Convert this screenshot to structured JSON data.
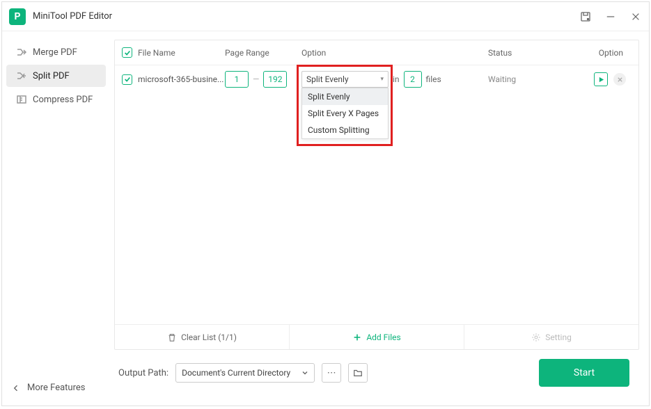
{
  "app": {
    "title": "MiniTool PDF Editor"
  },
  "sidebar": {
    "items": [
      {
        "label": "Merge PDF"
      },
      {
        "label": "Split PDF"
      },
      {
        "label": "Compress PDF"
      }
    ],
    "more": "More Features"
  },
  "table": {
    "headers": {
      "filename": "File Name",
      "range": "Page Range",
      "option": "Option",
      "status": "Status",
      "option2": "Option"
    },
    "row": {
      "filename": "microsoft-365-busine...",
      "range_from": "1",
      "range_to": "192",
      "select_value": "Split Evenly",
      "in_text": "in",
      "count": "2",
      "files_text": "files",
      "status": "Waiting"
    },
    "dropdown": [
      "Split Evenly",
      "Split Every X Pages",
      "Custom Splitting"
    ],
    "footer": {
      "clear": "Clear List (1/1)",
      "add": "Add Files",
      "setting": "Setting"
    }
  },
  "output": {
    "label": "Output Path:",
    "value": "Document's Current Directory"
  },
  "actions": {
    "start": "Start"
  }
}
